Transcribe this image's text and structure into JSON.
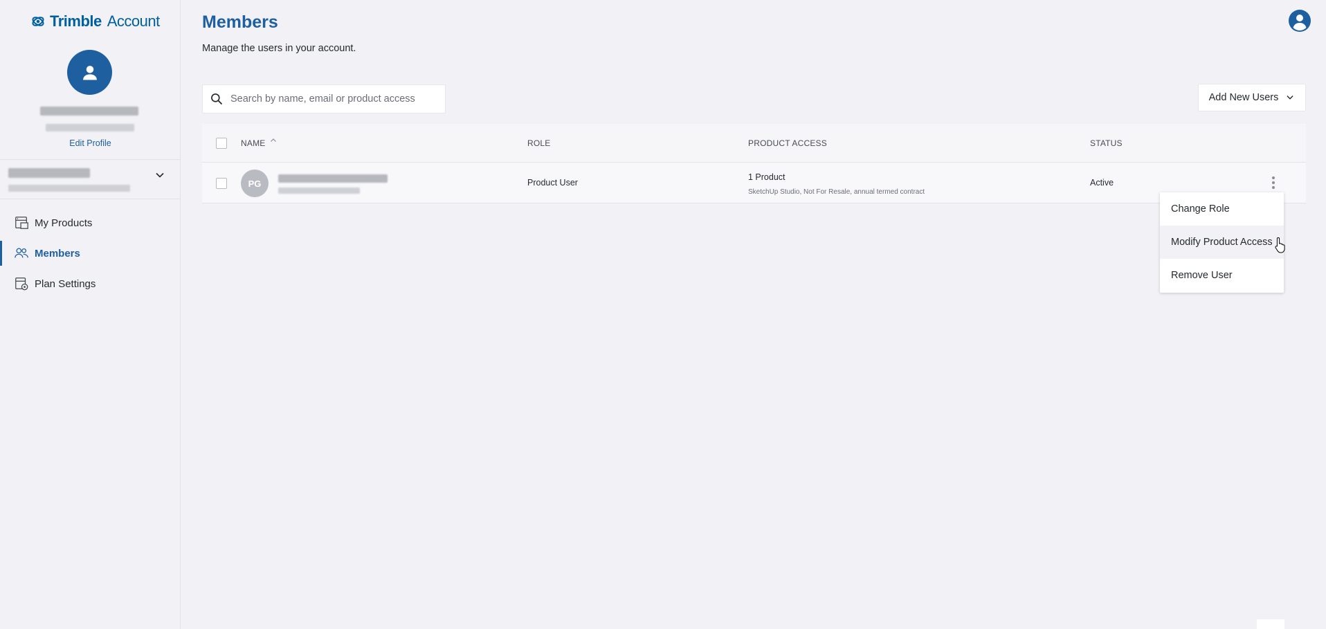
{
  "brand": {
    "name": "Trimble",
    "product": "Account"
  },
  "sidebar": {
    "edit_profile": "Edit Profile",
    "nav": [
      {
        "label": "My Products",
        "icon": "products-icon",
        "active": false
      },
      {
        "label": "Members",
        "icon": "members-icon",
        "active": true
      },
      {
        "label": "Plan Settings",
        "icon": "plan-settings-icon",
        "active": false
      }
    ]
  },
  "header": {
    "title": "Members",
    "subtitle": "Manage the users in your account."
  },
  "search": {
    "placeholder": "Search by name, email or product access",
    "value": ""
  },
  "actions": {
    "add_users": "Add New Users"
  },
  "table": {
    "columns": [
      "NAME",
      "ROLE",
      "PRODUCT ACCESS",
      "STATUS"
    ],
    "rows": [
      {
        "initials": "PG",
        "role": "Product User",
        "product_access": "1 Product",
        "product_detail": "SketchUp Studio, Not For Resale, annual termed contract",
        "status": "Active"
      }
    ]
  },
  "row_menu": {
    "items": [
      "Change Role",
      "Modify Product Access",
      "Remove User"
    ]
  },
  "colors": {
    "accent": "#1e5fa0",
    "background": "#f1f1f6",
    "avatar_grey": "#b9bbc2"
  }
}
